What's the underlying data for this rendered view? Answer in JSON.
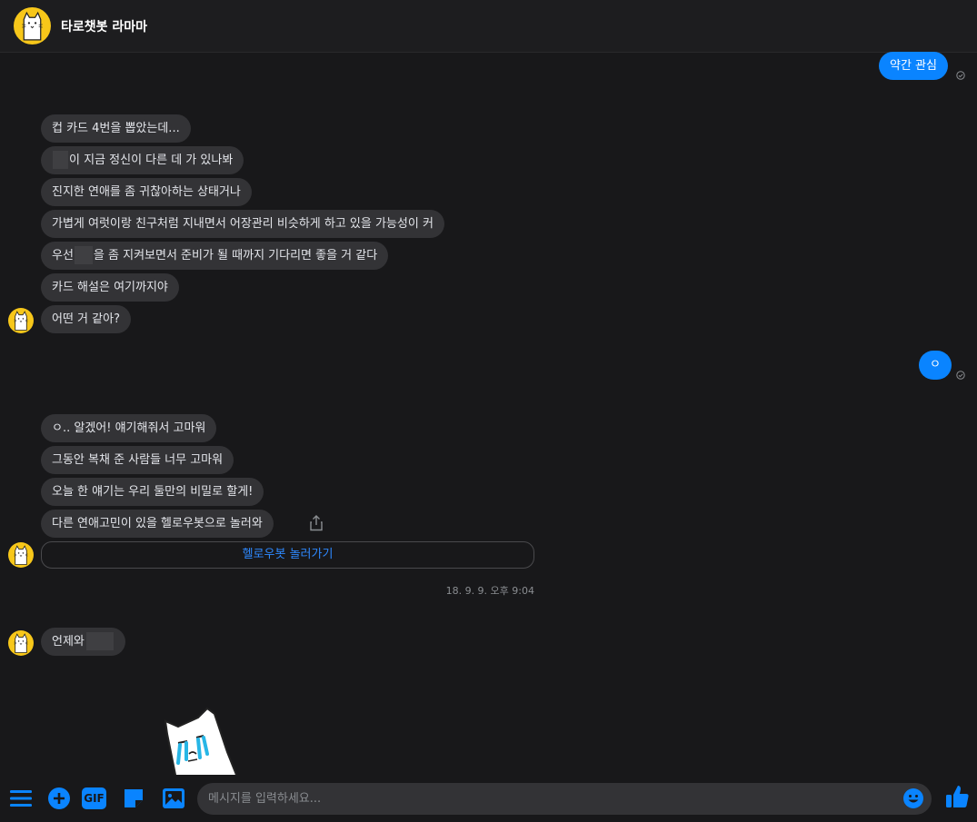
{
  "header": {
    "title": "타로챗봇 라마마",
    "avatar_icon": "cat-mascot-icon"
  },
  "messages": {
    "m1": "약간 관심",
    "m2": "컵 카드 4번을 뽑았는데...",
    "m3_after": "이 지금 정신이 다른 데 가 있나봐",
    "m4": "진지한 연애를 좀 귀찮아하는 상태거나",
    "m5": "가볍게 여럿이랑 친구처럼 지내면서 어장관리 비슷하게 하고 있을 가능성이 커",
    "m6_before": "우선",
    "m6_after": "을 좀 지켜보면서 준비가 될 때까지 기다리면 좋을 거 같다",
    "m7": "카드 해설은 여기까지야",
    "m8": "어떤 거 같아?",
    "m9": "ㅇ",
    "m10": "ㅇ.. 알겠어! 얘기해줘서 고마워",
    "m11": "그동안 복채 준 사람들 너무 고마워",
    "m12": "오늘 한 얘기는 우리 둘만의 비밀로 할게!",
    "m13": "다른 연애고민이 있을  헬로우봇으로 놀러와",
    "m14_before": "언제와"
  },
  "link_button": "헬로우봇 놀러가기",
  "timestamp": "18. 9. 9. 오후 9:04",
  "composer": {
    "placeholder": "메시지를 입력하세요...",
    "gif_label": "GIF"
  },
  "colors": {
    "accent": "#0a84ff",
    "incoming_bubble": "#333336",
    "background": "#18181a",
    "avatar_yellow": "#f7c71a"
  }
}
